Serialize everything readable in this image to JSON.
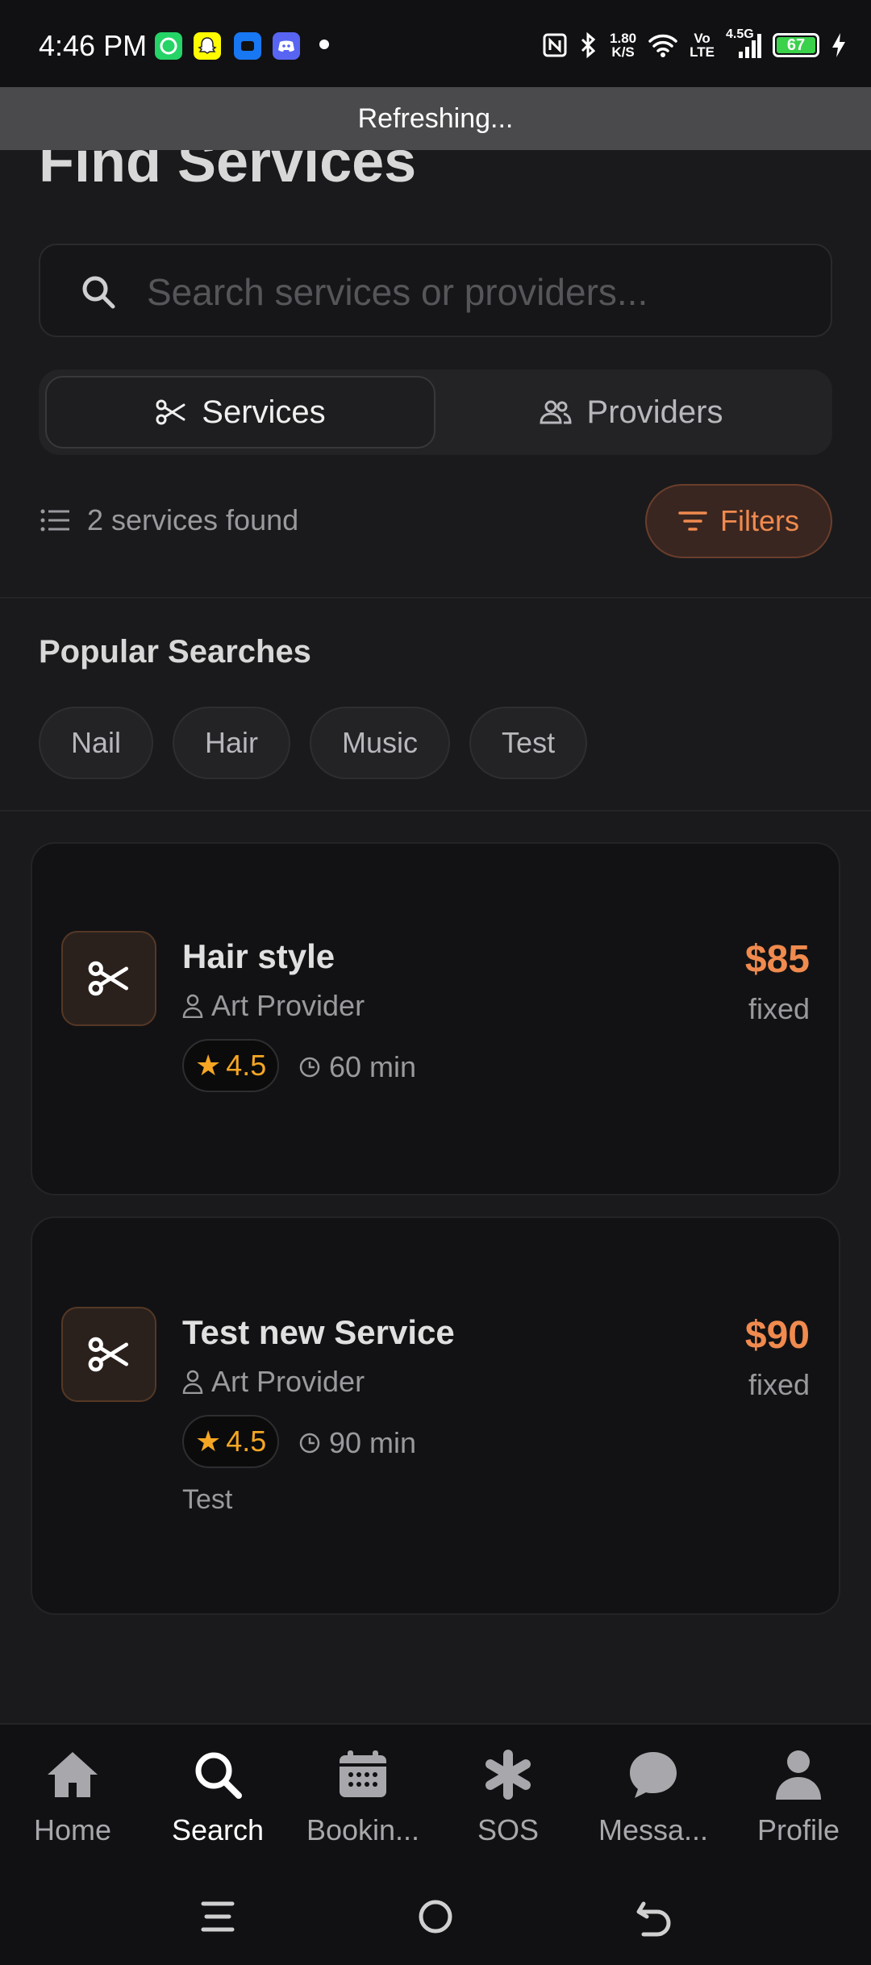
{
  "status_bar": {
    "time": "4:46 PM",
    "net_speed_top": "1.80",
    "net_speed_bottom": "K/S",
    "volte_top": "Vo",
    "volte_bottom": "LTE",
    "network": "4.5G",
    "battery": "67",
    "app_icons": [
      "whatsapp-icon",
      "snapchat-icon",
      "messenger-icon",
      "discord-icon"
    ]
  },
  "banner": {
    "text": "Refreshing..."
  },
  "page": {
    "title": "Find Services"
  },
  "search": {
    "placeholder": "Search services or providers..."
  },
  "segments": {
    "services": "Services",
    "providers": "Providers"
  },
  "results": {
    "count_text": "2 services found",
    "filters_label": "Filters"
  },
  "popular": {
    "title": "Popular Searches",
    "chips": [
      "Nail",
      "Hair",
      "Music",
      "Test"
    ]
  },
  "services": [
    {
      "title": "Hair style",
      "provider": "Art Provider",
      "rating": "4.5",
      "duration": "60 min",
      "price": "$85",
      "price_type": "fixed",
      "description": ""
    },
    {
      "title": "Test new Service",
      "provider": "Art Provider",
      "rating": "4.5",
      "duration": "90 min",
      "price": "$90",
      "price_type": "fixed",
      "description": "Test"
    }
  ],
  "nav": {
    "items": [
      {
        "label": "Home",
        "icon": "home-icon"
      },
      {
        "label": "Search",
        "icon": "search-icon"
      },
      {
        "label": "Bookin...",
        "icon": "calendar-icon"
      },
      {
        "label": "SOS",
        "icon": "asterisk-icon"
      },
      {
        "label": "Messa...",
        "icon": "chat-icon"
      },
      {
        "label": "Profile",
        "icon": "person-icon"
      }
    ],
    "active": "Search"
  },
  "colors": {
    "accent": "#f08a4e",
    "rating": "#f5a623",
    "background": "#1a1a1c",
    "battery": "#3ad14b"
  }
}
